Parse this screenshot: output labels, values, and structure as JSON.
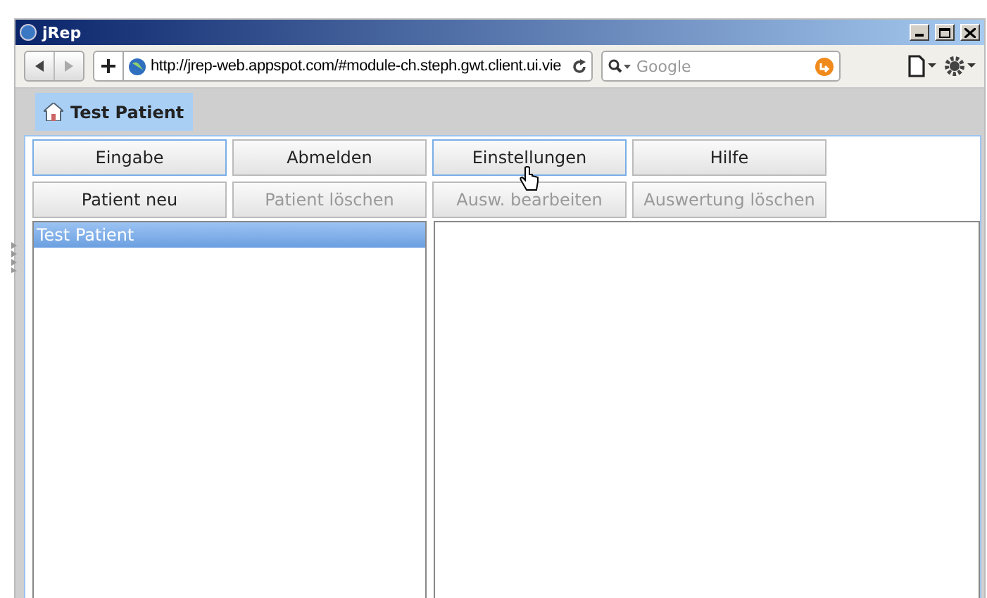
{
  "window": {
    "title": "jRep"
  },
  "browser": {
    "url": "http://jrep-web.appspot.com/#module-ch.steph.gwt.client.ui.vie",
    "search_placeholder": "Google"
  },
  "tab": {
    "label": "Test Patient"
  },
  "button_rows": [
    [
      {
        "label": "Eingabe",
        "disabled": false,
        "highlighted": true
      },
      {
        "label": "Abmelden",
        "disabled": false,
        "highlighted": false
      },
      {
        "label": "Einstellungen",
        "disabled": false,
        "highlighted": true
      },
      {
        "label": "Hilfe",
        "disabled": false,
        "highlighted": false
      }
    ],
    [
      {
        "label": "Patient neu",
        "disabled": false,
        "highlighted": false
      },
      {
        "label": "Patient löschen",
        "disabled": true,
        "highlighted": false
      },
      {
        "label": "Ausw. bearbeiten",
        "disabled": true,
        "highlighted": false
      },
      {
        "label": "Auswertung löschen",
        "disabled": true,
        "highlighted": false
      }
    ]
  ],
  "patients": [
    {
      "label": "Test Patient",
      "selected": true
    }
  ]
}
